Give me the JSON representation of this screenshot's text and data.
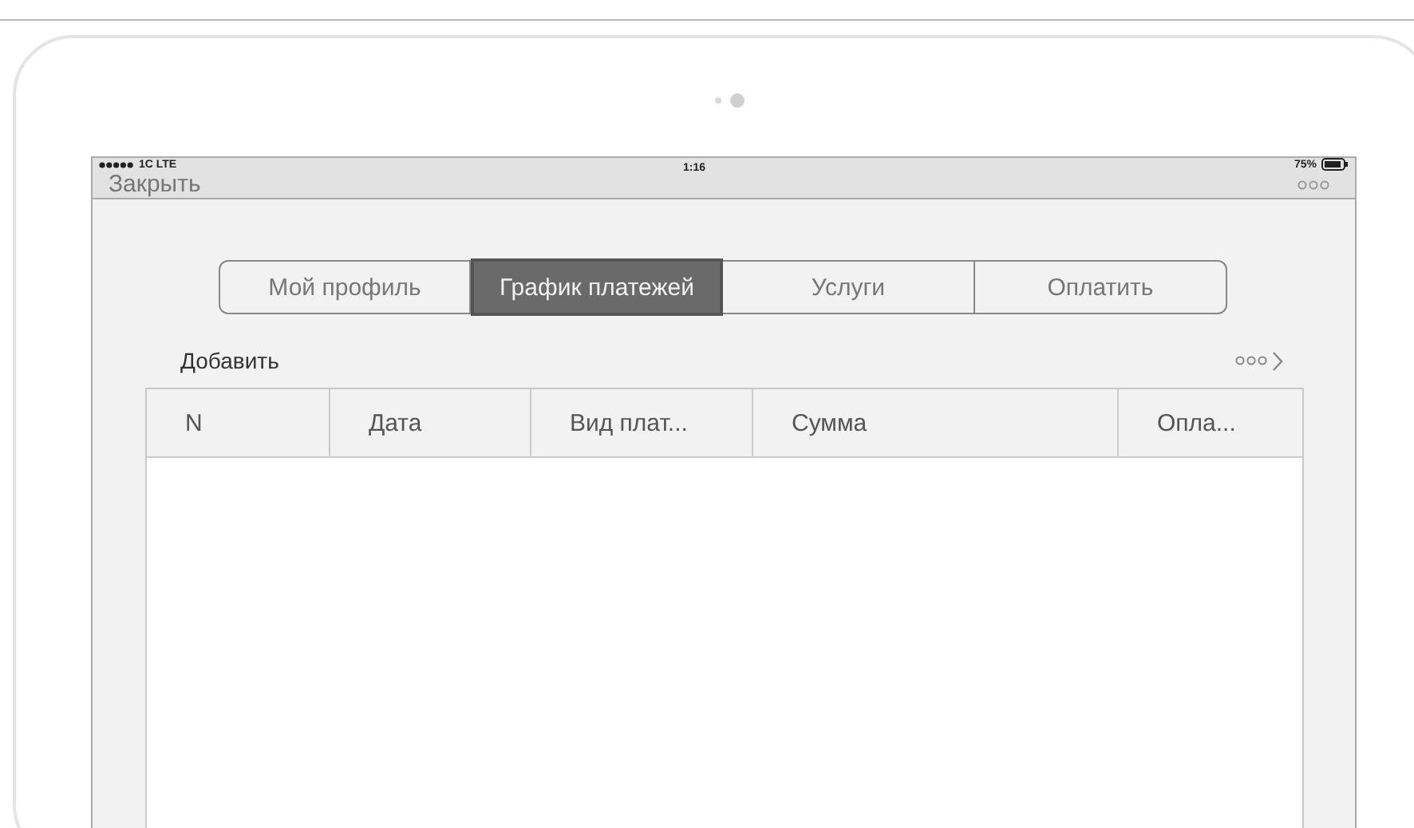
{
  "status_bar": {
    "carrier": "1C LTE",
    "time": "1:16",
    "battery": "75%"
  },
  "nav_bar": {
    "close": "Закрыть"
  },
  "tabs": [
    {
      "label": "Мой профиль",
      "selected": false
    },
    {
      "label": "График платежей",
      "selected": true
    },
    {
      "label": "Услуги",
      "selected": false
    },
    {
      "label": "Оплатить",
      "selected": false
    }
  ],
  "toolbar": {
    "add": "Добавить"
  },
  "table": {
    "columns": [
      "N",
      "Дата",
      "Вид плат...",
      "Сумма",
      "Опла..."
    ]
  }
}
